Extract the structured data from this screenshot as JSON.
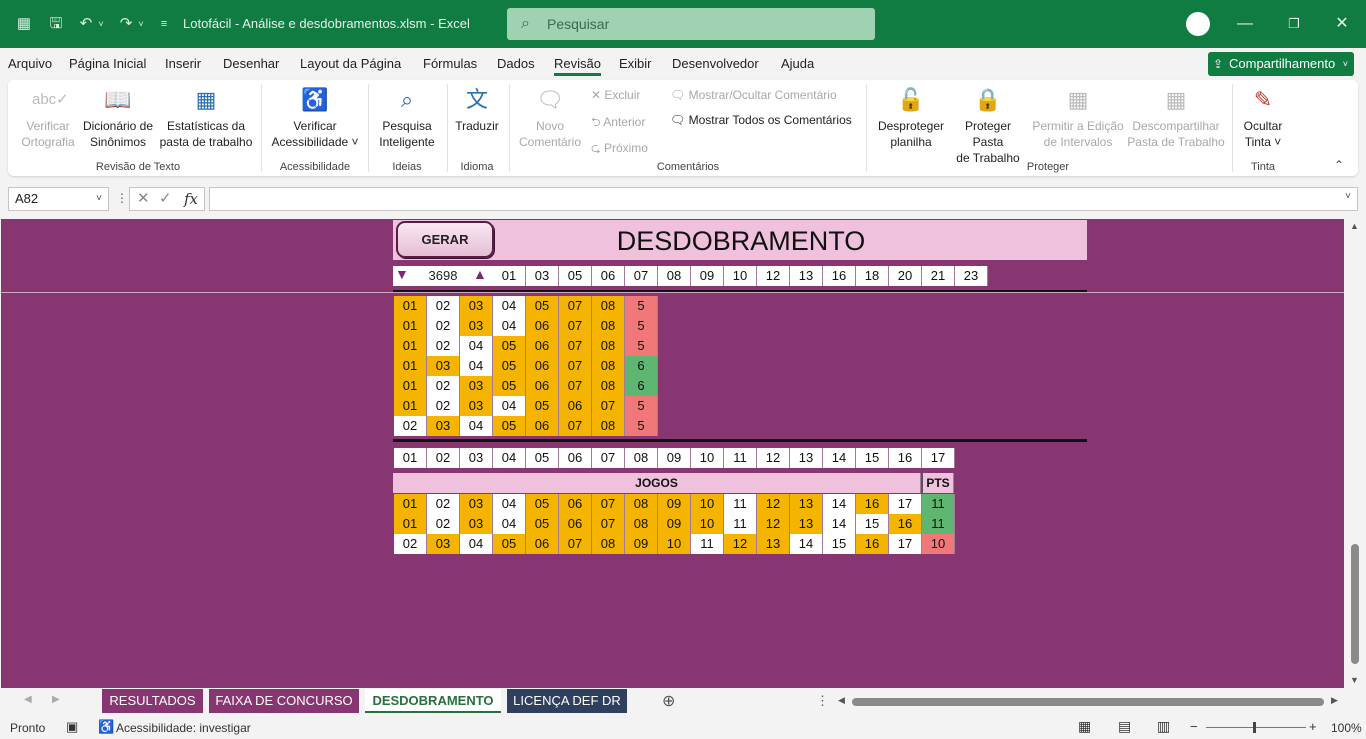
{
  "titlebar": {
    "title": "Lotofácil - Análise e desdobramentos.xlsm  -  Excel",
    "search_placeholder": "Pesquisar"
  },
  "menu": [
    "Arquivo",
    "Página Inicial",
    "Inserir",
    "Desenhar",
    "Layout da Página",
    "Fórmulas",
    "Dados",
    "Revisão",
    "Exibir",
    "Desenvolvedor",
    "Ajuda"
  ],
  "active_menu": "Revisão",
  "share_label": "Compartilhamento",
  "ribbon": {
    "verificar_ortografia": [
      "Verificar",
      "Ortografia"
    ],
    "dicionario": [
      "Dicionário de",
      "Sinônimos"
    ],
    "estatisticas": [
      "Estatísticas da",
      "pasta de trabalho"
    ],
    "grp_revisao": "Revisão de Texto",
    "acessibilidade": [
      "Verificar",
      "Acessibilidade ˅"
    ],
    "grp_acessibilidade": "Acessibilidade",
    "pesquisa": [
      "Pesquisa",
      "Inteligente"
    ],
    "grp_ideias": "Ideias",
    "traduzir": "Traduzir",
    "grp_idioma": "Idioma",
    "novo_comentario": [
      "Novo",
      "Comentário"
    ],
    "excluir": "Excluir",
    "anterior": "Anterior",
    "proximo": "Próximo",
    "mostrar_ocultar": "Mostrar/Ocultar Comentário",
    "mostrar_todos": "Mostrar Todos os Comentários",
    "grp_comentarios": "Comentários",
    "desproteger": [
      "Desproteger",
      "planilha"
    ],
    "proteger_pasta": [
      "Proteger Pasta",
      "de Trabalho"
    ],
    "permitir": [
      "Permitir a Edição",
      "de Intervalos"
    ],
    "descompartilhar": [
      "Descompartilhar",
      "Pasta de Trabalho"
    ],
    "grp_proteger": "Proteger",
    "ocultar_tinta": [
      "Ocultar",
      "Tinta ˅"
    ],
    "grp_tinta": "Tinta"
  },
  "formula": {
    "namebox": "A82",
    "fx": "fx",
    "content": ""
  },
  "sheet": {
    "gerar": "GERAR",
    "title": "DESDOBRAMENTO",
    "count": "3698",
    "selected_numbers": [
      "01",
      "03",
      "05",
      "06",
      "07",
      "08",
      "09",
      "10",
      "12",
      "13",
      "16",
      "18",
      "20",
      "21",
      "23"
    ],
    "combos": [
      {
        "nums": [
          [
            "01",
            "o"
          ],
          [
            "02",
            "w"
          ],
          [
            "03",
            "o"
          ],
          [
            "04",
            "w"
          ],
          [
            "05",
            "o"
          ],
          [
            "07",
            "o"
          ],
          [
            "08",
            "o"
          ]
        ],
        "score": "5",
        "sc": "r"
      },
      {
        "nums": [
          [
            "01",
            "o"
          ],
          [
            "02",
            "w"
          ],
          [
            "03",
            "o"
          ],
          [
            "04",
            "w"
          ],
          [
            "06",
            "o"
          ],
          [
            "07",
            "o"
          ],
          [
            "08",
            "o"
          ]
        ],
        "score": "5",
        "sc": "r"
      },
      {
        "nums": [
          [
            "01",
            "o"
          ],
          [
            "02",
            "w"
          ],
          [
            "04",
            "w"
          ],
          [
            "05",
            "o"
          ],
          [
            "06",
            "o"
          ],
          [
            "07",
            "o"
          ],
          [
            "08",
            "o"
          ]
        ],
        "score": "5",
        "sc": "r"
      },
      {
        "nums": [
          [
            "01",
            "o"
          ],
          [
            "03",
            "o"
          ],
          [
            "04",
            "w"
          ],
          [
            "05",
            "o"
          ],
          [
            "06",
            "o"
          ],
          [
            "07",
            "o"
          ],
          [
            "08",
            "o"
          ]
        ],
        "score": "6",
        "sc": "g"
      },
      {
        "nums": [
          [
            "01",
            "o"
          ],
          [
            "02",
            "w"
          ],
          [
            "03",
            "o"
          ],
          [
            "05",
            "o"
          ],
          [
            "06",
            "o"
          ],
          [
            "07",
            "o"
          ],
          [
            "08",
            "o"
          ]
        ],
        "score": "6",
        "sc": "g"
      },
      {
        "nums": [
          [
            "01",
            "o"
          ],
          [
            "02",
            "w"
          ],
          [
            "03",
            "o"
          ],
          [
            "04",
            "w"
          ],
          [
            "05",
            "o"
          ],
          [
            "06",
            "o"
          ],
          [
            "07",
            "o"
          ]
        ],
        "score": "5",
        "sc": "r"
      },
      {
        "nums": [
          [
            "02",
            "w"
          ],
          [
            "03",
            "o"
          ],
          [
            "04",
            "w"
          ],
          [
            "05",
            "o"
          ],
          [
            "06",
            "o"
          ],
          [
            "07",
            "o"
          ],
          [
            "08",
            "o"
          ]
        ],
        "score": "5",
        "sc": "r"
      }
    ],
    "index_row": [
      "01",
      "02",
      "03",
      "04",
      "05",
      "06",
      "07",
      "08",
      "09",
      "10",
      "11",
      "12",
      "13",
      "14",
      "15",
      "16",
      "17"
    ],
    "jogos_label": "JOGOS",
    "pts_label": "PTS",
    "games": [
      {
        "nums": [
          [
            "01",
            "o"
          ],
          [
            "02",
            "w"
          ],
          [
            "03",
            "o"
          ],
          [
            "04",
            "w"
          ],
          [
            "05",
            "o"
          ],
          [
            "06",
            "o"
          ],
          [
            "07",
            "o"
          ],
          [
            "08",
            "o"
          ],
          [
            "09",
            "o"
          ],
          [
            "10",
            "o"
          ],
          [
            "11",
            "w"
          ],
          [
            "12",
            "o"
          ],
          [
            "13",
            "o"
          ],
          [
            "14",
            "w"
          ],
          [
            "16",
            "o"
          ],
          [
            "17",
            "w"
          ]
        ],
        "pts": "11",
        "pc": "g"
      },
      {
        "nums": [
          [
            "01",
            "o"
          ],
          [
            "02",
            "w"
          ],
          [
            "03",
            "o"
          ],
          [
            "04",
            "w"
          ],
          [
            "05",
            "o"
          ],
          [
            "06",
            "o"
          ],
          [
            "07",
            "o"
          ],
          [
            "08",
            "o"
          ],
          [
            "09",
            "o"
          ],
          [
            "10",
            "o"
          ],
          [
            "11",
            "w"
          ],
          [
            "12",
            "o"
          ],
          [
            "13",
            "o"
          ],
          [
            "14",
            "w"
          ],
          [
            "15",
            "w"
          ],
          [
            "16",
            "o"
          ]
        ],
        "pts": "11",
        "pc": "g"
      },
      {
        "nums": [
          [
            "02",
            "w"
          ],
          [
            "03",
            "o"
          ],
          [
            "04",
            "w"
          ],
          [
            "05",
            "o"
          ],
          [
            "06",
            "o"
          ],
          [
            "07",
            "o"
          ],
          [
            "08",
            "o"
          ],
          [
            "09",
            "o"
          ],
          [
            "10",
            "o"
          ],
          [
            "11",
            "w"
          ],
          [
            "12",
            "o"
          ],
          [
            "13",
            "o"
          ],
          [
            "14",
            "w"
          ],
          [
            "15",
            "w"
          ],
          [
            "16",
            "o"
          ],
          [
            "17",
            "w"
          ]
        ],
        "pts": "10",
        "pc": "r"
      }
    ]
  },
  "tabs": [
    {
      "label": "RESULTADOS",
      "color": "#883672"
    },
    {
      "label": "FAIXA DE CONCURSO",
      "color": "#883672"
    },
    {
      "label": "DESDOBRAMENTO",
      "color": "#ffffff",
      "active": true
    },
    {
      "label": "LICENÇA DEF DR",
      "color": "#2f3f5e"
    }
  ],
  "status": {
    "ready": "Pronto",
    "accessibility": "Acessibilidade: investigar",
    "zoom": "100%"
  }
}
